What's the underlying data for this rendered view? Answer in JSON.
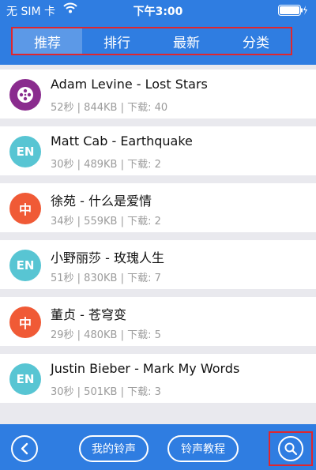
{
  "status_bar": {
    "carrier": "无 SIM 卡",
    "time": "下午3:00"
  },
  "tabs": [
    {
      "label": "推荐",
      "active": true
    },
    {
      "label": "排行",
      "active": false
    },
    {
      "label": "最新",
      "active": false
    },
    {
      "label": "分类",
      "active": false
    }
  ],
  "songs": [
    {
      "title": "Adam Levine - Lost Stars",
      "meta": "52秒 | 844KB | 下载: 40",
      "avatar": "music-disc-icon",
      "avatar_text": ""
    },
    {
      "title": "Matt Cab - Earthquake",
      "meta": "30秒 | 489KB | 下载: 2",
      "avatar": "en-badge",
      "avatar_text": "EN"
    },
    {
      "title": "徐苑 - 什么是爱情",
      "meta": "34秒 | 559KB | 下载: 2",
      "avatar": "zh-badge",
      "avatar_text": "中"
    },
    {
      "title": "小野丽莎 - 玫瑰人生",
      "meta": "51秒 | 830KB | 下载: 7",
      "avatar": "en-badge",
      "avatar_text": "EN"
    },
    {
      "title": "董贞 - 苍穹变",
      "meta": "29秒 | 480KB | 下载: 5",
      "avatar": "zh-badge",
      "avatar_text": "中"
    },
    {
      "title": "Justin Bieber - Mark My Words",
      "meta": "30秒 | 501KB | 下载: 3",
      "avatar": "en-badge",
      "avatar_text": "EN"
    }
  ],
  "bottom_bar": {
    "my_ringtones": "我的铃声",
    "tutorial": "铃声教程"
  },
  "colors": {
    "primary": "#2f7de1",
    "highlight_border": "#e0262d",
    "en_badge": "#58c5d3",
    "zh_badge": "#f05a36",
    "music_badge": "#8a2c8e"
  }
}
